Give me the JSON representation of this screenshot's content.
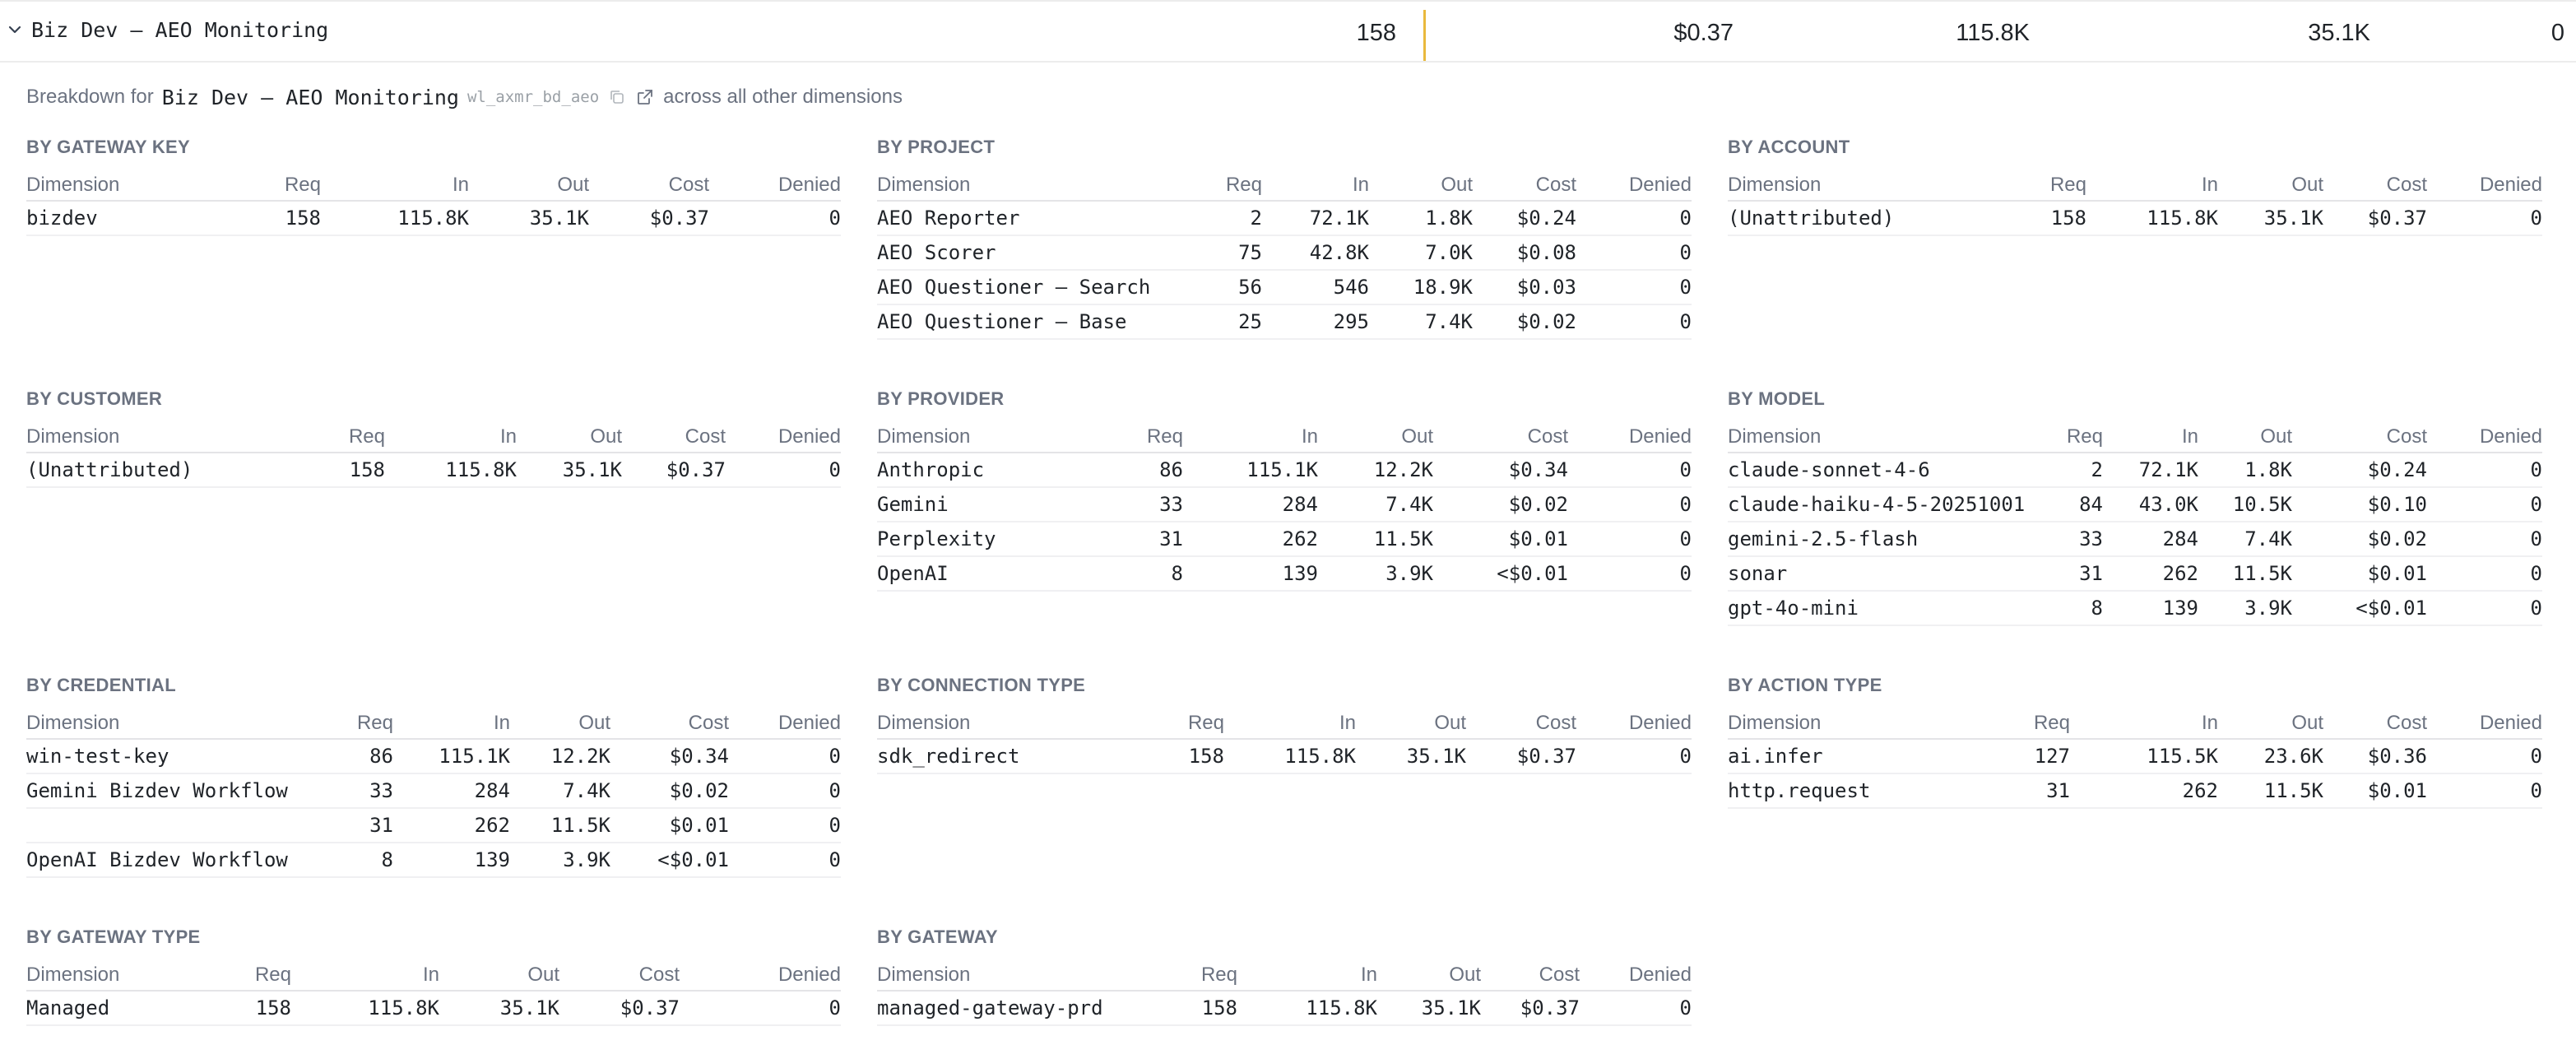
{
  "header": {
    "title": "Biz Dev — AEO Monitoring",
    "requests": "158",
    "cost": "$0.37",
    "input": "115.8K",
    "output": "35.1K",
    "denied": "0"
  },
  "breakdown": {
    "prefix": "Breakdown for",
    "name": "Biz Dev — AEO Monitoring",
    "workload_id": "wl_axmr_bd_aeo",
    "suffix": "across all other dimensions"
  },
  "columns": {
    "dimension": "Dimension",
    "req": "Req",
    "in": "In",
    "out": "Out",
    "cost": "Cost",
    "denied": "Denied"
  },
  "sections": [
    {
      "title": "BY GATEWAY KEY",
      "rows": [
        [
          "bizdev",
          "158",
          "115.8K",
          "35.1K",
          "$0.37",
          "0"
        ]
      ]
    },
    {
      "title": "BY PROJECT",
      "rows": [
        [
          "AEO Reporter",
          "2",
          "72.1K",
          "1.8K",
          "$0.24",
          "0"
        ],
        [
          "AEO Scorer",
          "75",
          "42.8K",
          "7.0K",
          "$0.08",
          "0"
        ],
        [
          "AEO Questioner — Search",
          "56",
          "546",
          "18.9K",
          "$0.03",
          "0"
        ],
        [
          "AEO Questioner — Base",
          "25",
          "295",
          "7.4K",
          "$0.02",
          "0"
        ]
      ]
    },
    {
      "title": "BY ACCOUNT",
      "rows": [
        [
          "(Unattributed)",
          "158",
          "115.8K",
          "35.1K",
          "$0.37",
          "0"
        ]
      ]
    },
    {
      "title": "BY CUSTOMER",
      "rows": [
        [
          "(Unattributed)",
          "158",
          "115.8K",
          "35.1K",
          "$0.37",
          "0"
        ]
      ]
    },
    {
      "title": "BY PROVIDER",
      "rows": [
        [
          "Anthropic",
          "86",
          "115.1K",
          "12.2K",
          "$0.34",
          "0"
        ],
        [
          "Gemini",
          "33",
          "284",
          "7.4K",
          "$0.02",
          "0"
        ],
        [
          "Perplexity",
          "31",
          "262",
          "11.5K",
          "$0.01",
          "0"
        ],
        [
          "OpenAI",
          "8",
          "139",
          "3.9K",
          "<$0.01",
          "0"
        ]
      ]
    },
    {
      "title": "BY MODEL",
      "rows": [
        [
          "claude-sonnet-4-6",
          "2",
          "72.1K",
          "1.8K",
          "$0.24",
          "0"
        ],
        [
          "claude-haiku-4-5-20251001",
          "84",
          "43.0K",
          "10.5K",
          "$0.10",
          "0"
        ],
        [
          "gemini-2.5-flash",
          "33",
          "284",
          "7.4K",
          "$0.02",
          "0"
        ],
        [
          "sonar",
          "31",
          "262",
          "11.5K",
          "$0.01",
          "0"
        ],
        [
          "gpt-4o-mini",
          "8",
          "139",
          "3.9K",
          "<$0.01",
          "0"
        ]
      ]
    },
    {
      "title": "BY CREDENTIAL",
      "rows": [
        [
          "win-test-key",
          "86",
          "115.1K",
          "12.2K",
          "$0.34",
          "0"
        ],
        [
          "Gemini Bizdev Workflow",
          "33",
          "284",
          "7.4K",
          "$0.02",
          "0"
        ],
        [
          "",
          "31",
          "262",
          "11.5K",
          "$0.01",
          "0"
        ],
        [
          "OpenAI Bizdev Workflow",
          "8",
          "139",
          "3.9K",
          "<$0.01",
          "0"
        ]
      ]
    },
    {
      "title": "BY CONNECTION TYPE",
      "rows": [
        [
          "sdk_redirect",
          "158",
          "115.8K",
          "35.1K",
          "$0.37",
          "0"
        ]
      ]
    },
    {
      "title": "BY ACTION TYPE",
      "rows": [
        [
          "ai.infer",
          "127",
          "115.5K",
          "23.6K",
          "$0.36",
          "0"
        ],
        [
          "http.request",
          "31",
          "262",
          "11.5K",
          "$0.01",
          "0"
        ]
      ]
    },
    {
      "title": "BY GATEWAY TYPE",
      "rows": [
        [
          "Managed",
          "158",
          "115.8K",
          "35.1K",
          "$0.37",
          "0"
        ]
      ]
    },
    {
      "title": "BY GATEWAY",
      "rows": [
        [
          "managed-gateway-prd",
          "158",
          "115.8K",
          "35.1K",
          "$0.37",
          "0"
        ]
      ]
    }
  ]
}
